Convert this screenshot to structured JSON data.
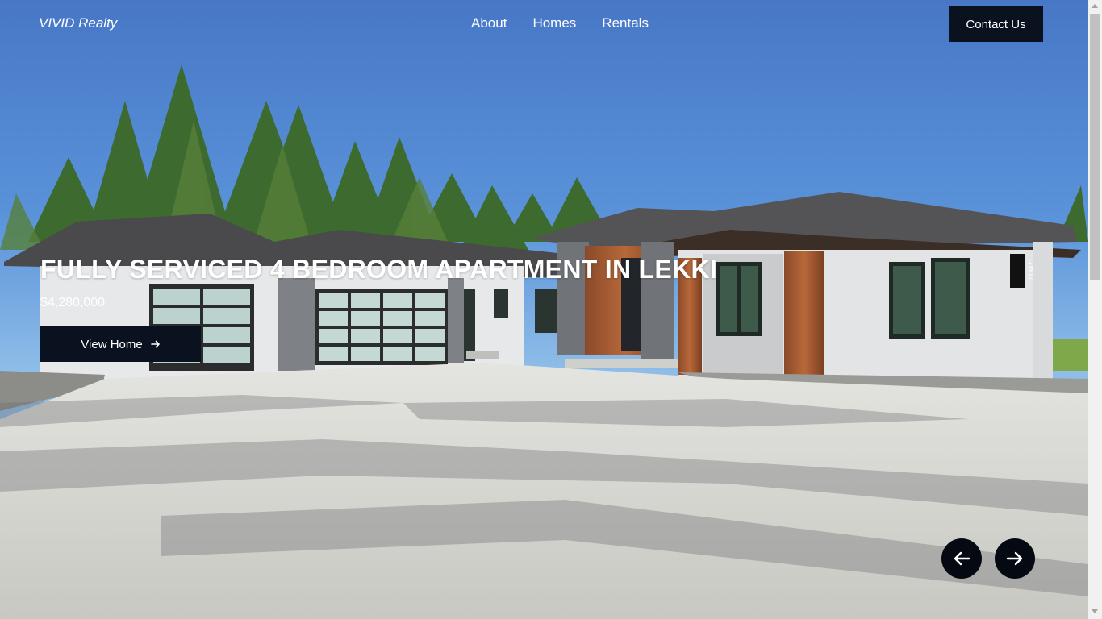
{
  "header": {
    "logo": "VIVID Realty",
    "nav": [
      "About",
      "Homes",
      "Rentals"
    ],
    "contact_label": "Contact Us"
  },
  "hero": {
    "title": "FULLY SERVICED 4 BEDROOM APARTMENT IN LEKKI",
    "price": "$4,280,000",
    "view_label": "View Home",
    "house_number": "7607",
    "image_description": "modern single-story house with concrete driveway and pine trees"
  },
  "carousel": {
    "prev_icon": "arrow-left-icon",
    "next_icon": "arrow-right-icon"
  },
  "colors": {
    "sky": "#4a7fcf",
    "dark_button": "#0a1220",
    "driveway": "#d9d9d4"
  }
}
